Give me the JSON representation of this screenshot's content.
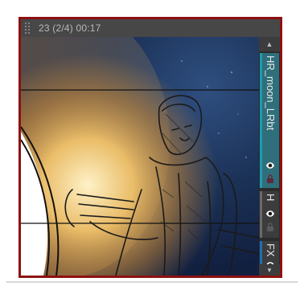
{
  "panel": {
    "header": "23 (2/4) 00:17",
    "frame_color": "#8e1111"
  },
  "layers": [
    {
      "name": "HR_moon_LRbt",
      "color": "#1f9bb0",
      "active": true,
      "visible": true
    },
    {
      "name": "H",
      "color": "#6a6a6a",
      "active": false,
      "visible": true
    },
    {
      "name": "FX",
      "color": "#1f6fb3",
      "active": false,
      "visible": true
    }
  ],
  "icons": {
    "grip": "drag-grip-icon",
    "up": "scroll-up-arrow-icon",
    "down": "scroll-down-arrow-icon",
    "eye": "eye-visibility-icon",
    "lock": "lock-icon"
  },
  "scroll": {
    "up_glyph": "▲",
    "down_glyph": "▼"
  }
}
